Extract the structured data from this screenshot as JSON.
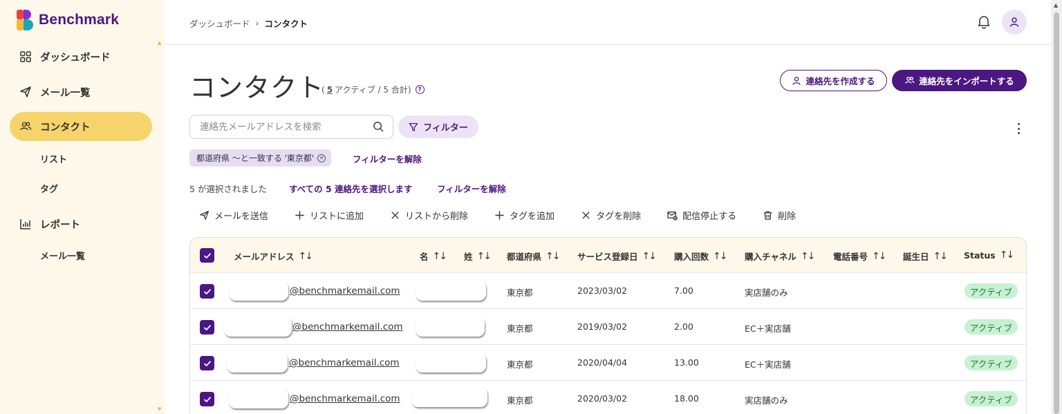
{
  "brand": {
    "name": "Benchmark",
    "colors": {
      "primary": "#4b1782",
      "sidebar_bg": "#fdf8ea",
      "active": "#f7d46b",
      "badge_bg": "#c5f2d0"
    }
  },
  "sidebar": {
    "items": [
      {
        "label": "ダッシュボード",
        "icon": "grid-icon"
      },
      {
        "label": "メール一覧",
        "icon": "send-icon"
      },
      {
        "label": "コンタクト",
        "icon": "contacts-icon",
        "active": true
      },
      {
        "label": "レポート",
        "icon": "chart-icon"
      }
    ],
    "contacts_sub": [
      "リスト",
      "タグ"
    ],
    "reports_sub": [
      "メール一覧"
    ]
  },
  "header": {
    "breadcrumb": [
      "ダッシュボード",
      "コンタクト"
    ],
    "breadcrumb_sep": "›"
  },
  "page": {
    "title": "コンタクト",
    "count_open": "(",
    "active_count": "5",
    "count_rest": " アクティブ / 5 合計)",
    "help": "?",
    "create_button": "連絡先を作成する",
    "import_button": "連絡先をインポートする"
  },
  "search": {
    "placeholder": "連絡先メールアドレスを検索"
  },
  "filter": {
    "button": "フィルター",
    "chip": "都道府県 〜と一致する '東京都'",
    "clear": "フィルターを解除"
  },
  "selection": {
    "text": "5 が選択されました",
    "select_all": "すべての 5 連絡先を選択します",
    "clear_filter": "フィルターを解除"
  },
  "actions": [
    {
      "label": "メールを送信",
      "icon": "send-icon"
    },
    {
      "label": "リストに追加",
      "icon": "plus-icon"
    },
    {
      "label": "リストから削除",
      "icon": "x-icon"
    },
    {
      "label": "タグを追加",
      "icon": "plus-icon"
    },
    {
      "label": "タグを削除",
      "icon": "x-icon"
    },
    {
      "label": "配信停止する",
      "icon": "unsubscribe-icon"
    },
    {
      "label": "削除",
      "icon": "trash-icon"
    }
  ],
  "table": {
    "sort_icon": "↑↓",
    "columns": [
      "メールアドレス",
      "名",
      "姓",
      "都道府県",
      "サービス登録日",
      "購入回数",
      "購入チャネル",
      "電話番号",
      "誕生日",
      "Status"
    ],
    "rows": [
      {
        "email_domain": "@benchmarkemail.com",
        "prefecture": "東京都",
        "registered": "2023/03/02",
        "purchases": "7.00",
        "channel": "実店舗のみ",
        "status": "アクティブ"
      },
      {
        "email_domain": "@benchmarkemail.com",
        "prefecture": "東京都",
        "registered": "2019/03/02",
        "purchases": "2.00",
        "channel": "EC＋実店舗",
        "status": "アクティブ"
      },
      {
        "email_domain": "@benchmarkemail.com",
        "prefecture": "東京都",
        "registered": "2020/04/04",
        "purchases": "13.00",
        "channel": "EC＋実店舗",
        "status": "アクティブ"
      },
      {
        "email_domain": "@benchmarkemail.com",
        "prefecture": "東京都",
        "registered": "2020/03/02",
        "purchases": "18.00",
        "channel": "実店舗のみ",
        "status": "アクティブ"
      }
    ]
  }
}
